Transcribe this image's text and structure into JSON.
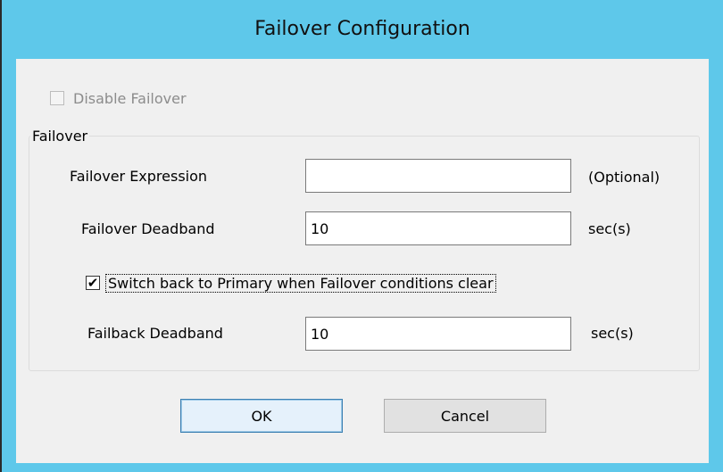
{
  "dialog": {
    "title": "Failover Configuration",
    "disable_failover": {
      "label": "Disable Failover",
      "checked": false,
      "enabled": false
    },
    "group_title": "Failover",
    "failover_expression": {
      "label": "Failover Expression",
      "value": "",
      "hint": "(Optional)"
    },
    "failover_deadband": {
      "label": "Failover Deadband",
      "value": "10",
      "unit": "sec(s)"
    },
    "switch_back": {
      "label": "Switch back to Primary when Failover conditions clear",
      "checked": true,
      "checkmark": "✔"
    },
    "failback_deadband": {
      "label": "Failback Deadband",
      "value": "10",
      "unit": "sec(s)"
    },
    "ok_label": "OK",
    "cancel_label": "Cancel"
  },
  "colors": {
    "titlebar": "#5ec8ea",
    "client": "#f0f0f0"
  },
  "icons": {
    "checkbox_checked": "checkmark-icon"
  }
}
